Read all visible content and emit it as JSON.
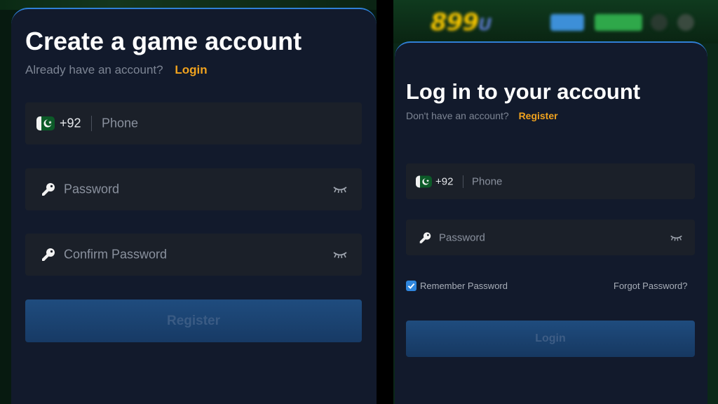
{
  "register": {
    "title": "Create a game account",
    "have_account_text": "Already have an account?",
    "login_link": "Login",
    "phone": {
      "country_code": "+92",
      "placeholder": "Phone",
      "flag": "pakistan-flag"
    },
    "password": {
      "placeholder": "Password",
      "icon": "key-icon",
      "toggle_icon": "eye-closed-icon"
    },
    "confirm_password": {
      "placeholder": "Confirm Password",
      "icon": "key-icon",
      "toggle_icon": "eye-closed-icon"
    },
    "submit_label": "Register"
  },
  "login": {
    "title": "Log in to your account",
    "no_account_text": "Don't have an account?",
    "register_link": "Register",
    "phone": {
      "country_code": "+92",
      "placeholder": "Phone",
      "flag": "pakistan-flag"
    },
    "password": {
      "placeholder": "Password",
      "icon": "key-icon",
      "toggle_icon": "eye-closed-icon"
    },
    "remember_label": "Remember Password",
    "remember_checked": true,
    "forgot_link": "Forgot Password?",
    "submit_label": "Login"
  },
  "colors": {
    "card_bg": "#121a2c",
    "field_bg": "#1b2029",
    "accent_link": "#f0a21e",
    "card_border": "#2f7fd6",
    "button_bg": "#1f4c7e",
    "checkbox": "#2f86de"
  }
}
